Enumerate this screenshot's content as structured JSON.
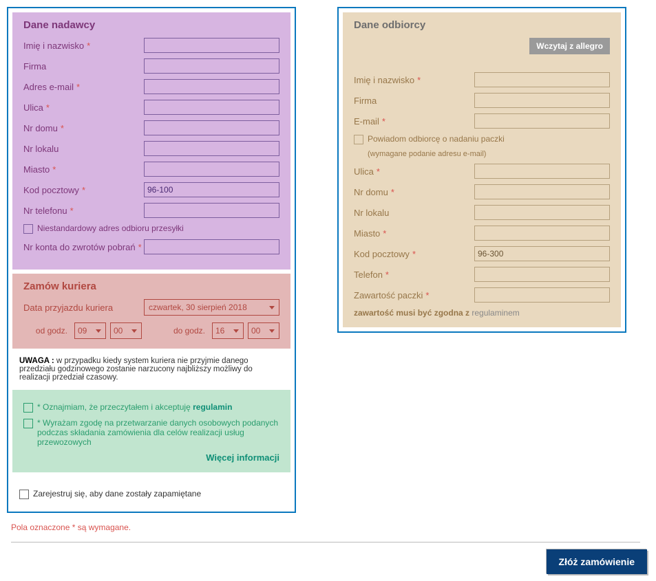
{
  "sender": {
    "heading": "Dane nadawcy",
    "fields": {
      "name": "Imię i nazwisko",
      "company": "Firma",
      "email": "Adres e-mail",
      "street": "Ulica",
      "house": "Nr domu",
      "apt": "Nr lokalu",
      "city": "Miasto",
      "postal": "Kod pocztowy",
      "postal_value": "96-100",
      "phone": "Nr telefonu",
      "nonstandard": "Niestandardowy adres odbioru przesyłki",
      "refund_acct": "Nr konta do zwrotów pobrań"
    }
  },
  "courier": {
    "heading": "Zamów kuriera",
    "arrival_label": "Data przyjazdu kuriera",
    "date_value": "czwartek, 30 sierpień 2018",
    "from_label": "od godz.",
    "to_label": "do godz.",
    "from_h": "09",
    "from_m": "00",
    "to_h": "16",
    "to_m": "00"
  },
  "warning": {
    "label": "UWAGA :",
    "text": " w przypadku kiedy system kuriera nie przyjmie danego przedziału godzinowego zostanie narzucony najbliższy możliwy do realizacji przedział czasowy."
  },
  "terms": {
    "accept_prefix": "* Oznajmiam, że przeczytałem i akceptuję ",
    "regulamin": "regulamin",
    "consent": "* Wyrażam zgodę na przetwarzanie danych osobowych podanych podczas składania zamówienia dla celów realizacji usług przewozowych",
    "more": "Więcej informacji"
  },
  "register": "Zarejestruj się, aby dane zostały zapamiętane",
  "recipient": {
    "heading": "Dane odbiorcy",
    "allegro_btn": "Wczytaj z allegro",
    "fields": {
      "name": "Imię i nazwisko",
      "company": "Firma",
      "email": "E-mail",
      "notify": "Powiadom odbiorcę o nadaniu paczki",
      "notify_note": "(wymagane podanie adresu e-mail)",
      "street": "Ulica",
      "house": "Nr domu",
      "apt": "Nr lokalu",
      "city": "Miasto",
      "postal": "Kod pocztowy",
      "postal_value": "96-300",
      "phone": "Telefon",
      "contents": "Zawartość paczki"
    },
    "warn_prefix": "zawartość musi być zgodna z ",
    "warn_link": "regulaminem"
  },
  "req_note": "Pola oznaczone * są wymagane.",
  "submit": "Złóż zamówienie"
}
